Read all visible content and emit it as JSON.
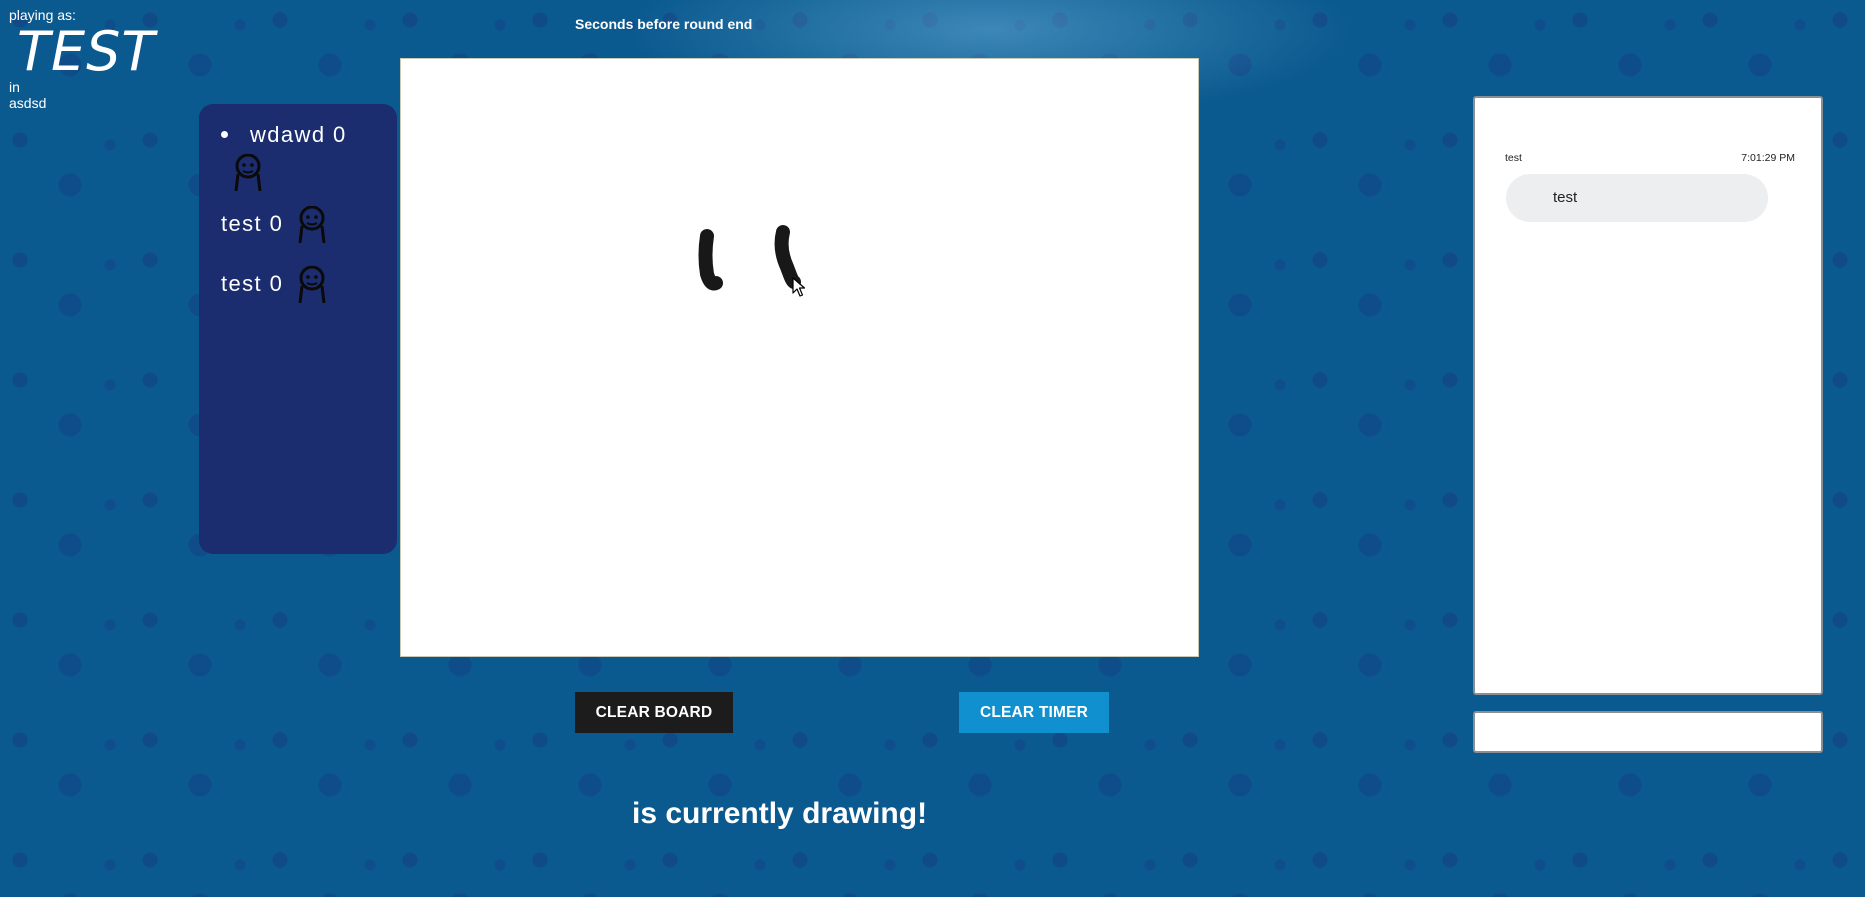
{
  "player": {
    "playing_as_label": "playing as:",
    "name": "TEST",
    "in_label": "in",
    "room": "asdsd"
  },
  "timer": {
    "label": "Seconds before round end"
  },
  "scoreboard": {
    "players": [
      {
        "label": "wdawd 0",
        "avatar_icon": "stick-figure-icon"
      },
      {
        "label": "test 0",
        "avatar_icon": "stick-figure-icon"
      },
      {
        "label": "test 0",
        "avatar_icon": "stick-figure-icon"
      }
    ]
  },
  "controls": {
    "clear_board": "CLEAR BOARD",
    "clear_timer": "CLEAR TIMER"
  },
  "status": {
    "drawing_text": "is currently drawing!"
  },
  "chat": {
    "messages": [
      {
        "user": "test",
        "time": "7:01:29 PM",
        "text": "test"
      }
    ],
    "input_value": ""
  },
  "colors": {
    "background": "#0b5a8f",
    "scoreboard_bg": "#1b2d6e",
    "clear_board_bg": "#1c1c1c",
    "clear_timer_bg": "#1190cf",
    "chat_bubble_bg": "#eceeef"
  }
}
